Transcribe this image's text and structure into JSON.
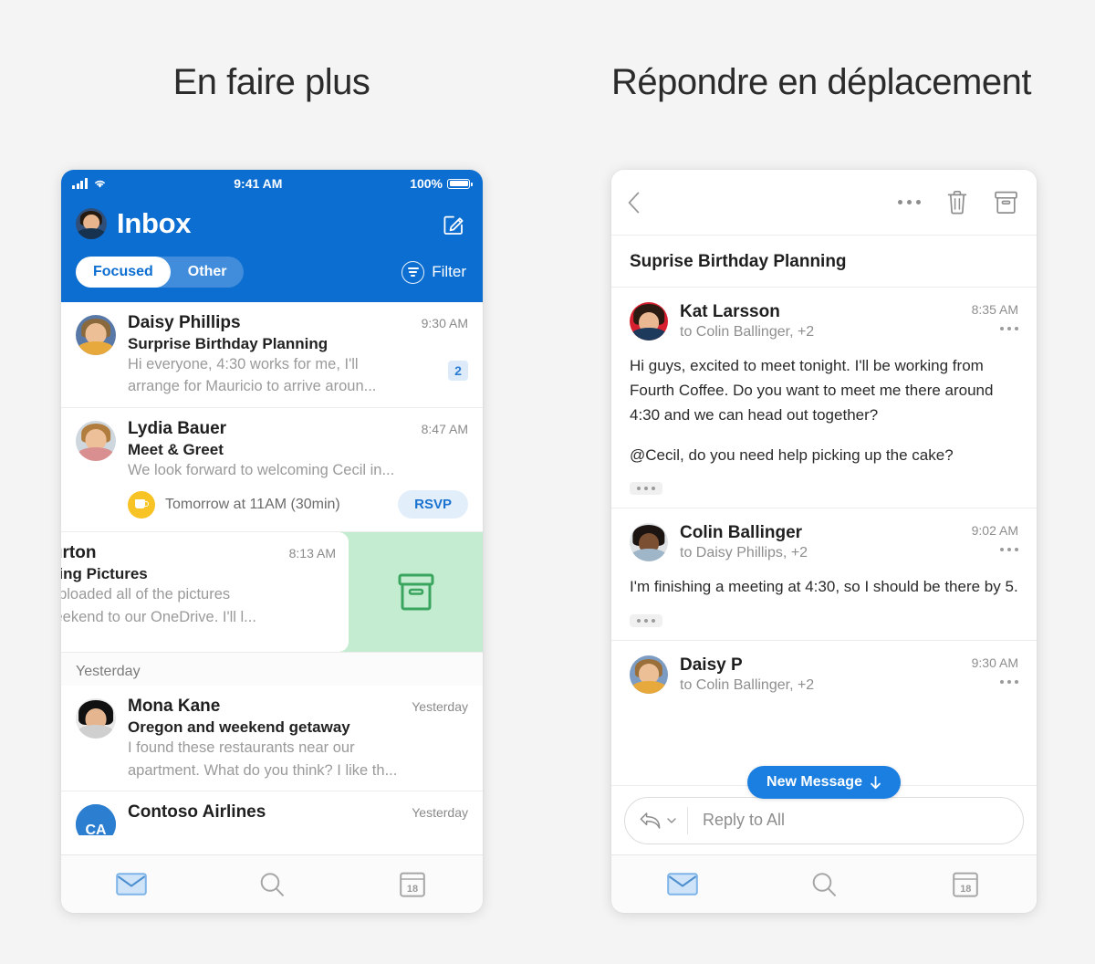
{
  "titles": {
    "left": "En faire plus",
    "right": "Répondre en déplacement"
  },
  "colors": {
    "header_blue": "#0c6ed1",
    "accent_blue": "#1a7fe0",
    "swipe_green_bg": "#c4ecd0",
    "swipe_green_icon": "#3aa55f",
    "meeting_yellow": "#f7c325",
    "rsvp_bg": "#e3eefb",
    "page_bg": "#f4f4f4"
  },
  "left_phone": {
    "status_bar": {
      "signal_icon": "cellular-signal-icon",
      "wifi_icon": "wifi-icon",
      "time": "9:41 AM",
      "battery_percent": "100%",
      "battery_icon": "battery-full-icon"
    },
    "header": {
      "avatar_icon": "account-avatar",
      "title": "Inbox",
      "compose_icon": "compose-icon",
      "tabs": [
        {
          "label": "Focused",
          "active": true
        },
        {
          "label": "Other",
          "active": false
        }
      ],
      "filter_label": "Filter",
      "filter_icon": "filter-icon"
    },
    "messages": [
      {
        "sender": "Daisy Phillips",
        "time": "9:30 AM",
        "subject": "Surprise Birthday Planning",
        "preview_line1": "Hi everyone, 4:30 works for me, I'll",
        "preview_line2": "arrange for Mauricio to arrive aroun...",
        "badge": "2"
      },
      {
        "sender": "Lydia Bauer",
        "time": "8:47 AM",
        "subject": "Meet & Greet",
        "preview_line1": "We look forward to welcoming Cecil in...",
        "meeting": {
          "icon": "coffee-meeting-icon",
          "text": "Tomorrow at 11AM (30min)",
          "action_label": "RSVP"
        }
      }
    ],
    "swiped_message": {
      "sender": "te Burton",
      "time": "8:13 AM",
      "subject": "Bonding Pictures",
      "preview_line1": "cil, I uploaded all of the pictures",
      "preview_line2": "ast weekend to our OneDrive. I'll l...",
      "action_icon": "archive-icon"
    },
    "day_separator": "Yesterday",
    "messages_yesterday": [
      {
        "sender": "Mona Kane",
        "time": "Yesterday",
        "subject": "Oregon and weekend getaway",
        "preview_line1": "I found these restaurants near our",
        "preview_line2": "apartment. What do you think? I like th..."
      },
      {
        "sender": "Contoso Airlines",
        "time": "Yesterday",
        "avatar_initials": "CA"
      }
    ],
    "tab_bar": [
      {
        "icon": "mail-icon",
        "active": true
      },
      {
        "icon": "search-icon",
        "active": false
      },
      {
        "icon": "calendar-icon",
        "day_number": "18",
        "active": false
      }
    ]
  },
  "right_phone": {
    "toolbar": {
      "back_icon": "back-chevron-icon",
      "more_icon": "more-options-icon",
      "delete_icon": "trash-icon",
      "archive_icon": "archive-icon"
    },
    "subject": "Suprise Birthday Planning",
    "messages": [
      {
        "sender": "Kat Larsson",
        "recipients": "to Colin Ballinger, +2",
        "time": "8:35 AM",
        "more_icon": "more-options-icon",
        "body": [
          "Hi guys, excited to meet tonight. I'll be working from Fourth Coffee. Do you want to meet me there around 4:30 and we can head out together?",
          "@Cecil, do you need help picking up the cake?"
        ],
        "expand_icon": "expand-quoted-text-icon"
      },
      {
        "sender": "Colin Ballinger",
        "recipients": "to Daisy Phillips, +2",
        "time": "9:02 AM",
        "more_icon": "more-options-icon",
        "body": [
          "I'm finishing a meeting at 4:30, so I should be there by 5."
        ],
        "expand_icon": "expand-quoted-text-icon"
      },
      {
        "sender": "Daisy P",
        "recipients": "to Colin Ballinger, +2",
        "time": "9:30 AM",
        "more_icon": "more-options-icon"
      }
    ],
    "new_message_pill": {
      "label": "New Message",
      "arrow_icon": "arrow-down-icon"
    },
    "reply_bar": {
      "reply_icon": "reply-all-icon",
      "chevron_icon": "chevron-down-icon",
      "placeholder": "Reply to All"
    },
    "tab_bar": [
      {
        "icon": "mail-icon",
        "active": true
      },
      {
        "icon": "search-icon",
        "active": false
      },
      {
        "icon": "calendar-icon",
        "day_number": "18",
        "active": false
      }
    ]
  }
}
